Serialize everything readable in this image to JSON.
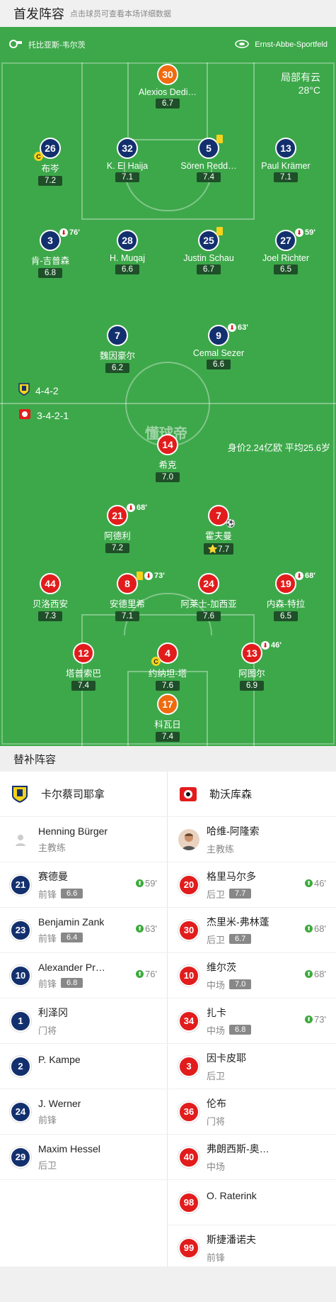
{
  "header": {
    "title": "首发阵容",
    "subtitle": "点击球员可查看本场详细数据"
  },
  "match": {
    "home_team": "托比亚斯-韦尔茨",
    "stadium": "Ernst-Abbe-Sportfeld",
    "weather": "局部有云",
    "temperature": "28°C"
  },
  "jena": {
    "formation": "4-4-2",
    "players": [
      {
        "num": "30",
        "name": "Alexios Dedi…",
        "rating": "6.7"
      },
      {
        "num": "26",
        "name": "布岑",
        "rating": "7.2"
      },
      {
        "num": "32",
        "name": "K. El Haija",
        "rating": "7.1"
      },
      {
        "num": "5",
        "name": "Sören Redd…",
        "rating": "7.4"
      },
      {
        "num": "13",
        "name": "Paul Krämer",
        "rating": "7.1"
      },
      {
        "num": "3",
        "name": "肯-吉普森",
        "rating": "6.8",
        "sub": "76'"
      },
      {
        "num": "28",
        "name": "H. Muqaj",
        "rating": "6.6"
      },
      {
        "num": "25",
        "name": "Justin Schau",
        "rating": "6.7"
      },
      {
        "num": "27",
        "name": "Joel Richter",
        "rating": "6.5",
        "sub": "59'"
      },
      {
        "num": "7",
        "name": "魏因豪尔",
        "rating": "6.2"
      },
      {
        "num": "9",
        "name": "Cemal Sezer",
        "rating": "6.6",
        "sub": "63'"
      }
    ]
  },
  "lev": {
    "formation": "3-4-2-1",
    "market": "身价2.24亿欧 平均25.6岁",
    "watermark": "懂球帝",
    "players": [
      {
        "num": "14",
        "name": "希克",
        "rating": "7.0"
      },
      {
        "num": "21",
        "name": "阿德利",
        "rating": "7.2",
        "sub": "68'"
      },
      {
        "num": "7",
        "name": "霍夫曼",
        "rating": "7.7"
      },
      {
        "num": "44",
        "name": "贝洛西安",
        "rating": "7.3"
      },
      {
        "num": "8",
        "name": "安德里希",
        "rating": "7.1",
        "sub": "73'"
      },
      {
        "num": "24",
        "name": "阿莱士-加西亚",
        "rating": "7.6"
      },
      {
        "num": "19",
        "name": "内森-特拉",
        "rating": "6.5",
        "sub": "68'"
      },
      {
        "num": "12",
        "name": "塔普索巴",
        "rating": "7.4"
      },
      {
        "num": "4",
        "name": "约纳坦-塔",
        "rating": "7.6"
      },
      {
        "num": "13",
        "name": "阿图尔",
        "rating": "6.9",
        "sub": "46'"
      },
      {
        "num": "17",
        "name": "科瓦日",
        "rating": "7.4"
      }
    ]
  },
  "subs": {
    "title": "替补阵容",
    "left": {
      "team": "卡尔蔡司耶拿",
      "coach": {
        "name": "Henning Bürger",
        "role": "主教练"
      },
      "players": [
        {
          "num": "21",
          "name": "赛德曼",
          "pos": "前锋",
          "rating": "6.6",
          "min": "59'"
        },
        {
          "num": "23",
          "name": "Benjamin Zank",
          "pos": "前锋",
          "rating": "6.4",
          "min": "63'"
        },
        {
          "num": "10",
          "name": "Alexander Pr…",
          "pos": "前锋",
          "rating": "6.8",
          "min": "76'"
        },
        {
          "num": "1",
          "name": "利泽冈",
          "pos": "门将"
        },
        {
          "num": "2",
          "name": "P. Kampe",
          "pos": ""
        },
        {
          "num": "24",
          "name": "J. Werner",
          "pos": "前锋"
        },
        {
          "num": "29",
          "name": "Maxim Hessel",
          "pos": "后卫"
        }
      ]
    },
    "right": {
      "team": "勒沃库森",
      "coach": {
        "name": "哈维-阿隆索",
        "role": "主教练"
      },
      "players": [
        {
          "num": "20",
          "name": "格里马尔多",
          "pos": "后卫",
          "rating": "7.7",
          "min": "46'"
        },
        {
          "num": "30",
          "name": "杰里米-弗林蓬",
          "pos": "后卫",
          "rating": "6.7",
          "min": "68'"
        },
        {
          "num": "10",
          "name": "维尔茨",
          "pos": "中场",
          "rating": "7.0",
          "min": "68'"
        },
        {
          "num": "34",
          "name": "扎卡",
          "pos": "中场",
          "rating": "6.8",
          "min": "73'"
        },
        {
          "num": "3",
          "name": "因卡皮耶",
          "pos": "后卫"
        },
        {
          "num": "36",
          "name": "伦布",
          "pos": "门将"
        },
        {
          "num": "40",
          "name": "弗朗西斯-奥…",
          "pos": "中场"
        },
        {
          "num": "98",
          "name": "O. Raterink",
          "pos": ""
        },
        {
          "num": "99",
          "name": "斯捷潘诺夫",
          "pos": "前锋"
        }
      ]
    }
  },
  "colors": {
    "pitch": "#3da84a",
    "jena": "#13306e",
    "leverkusen": "#e21c1c",
    "keeper": "#f06a0e"
  }
}
